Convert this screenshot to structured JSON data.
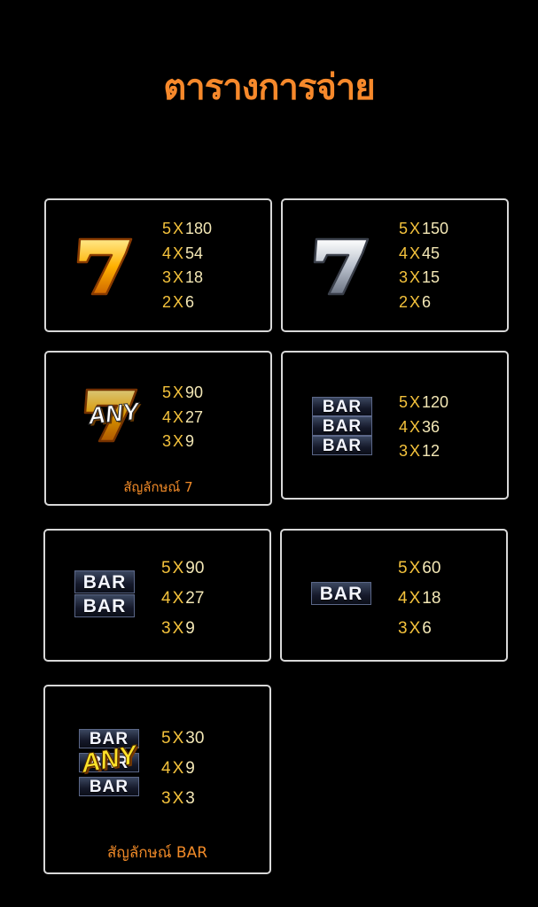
{
  "title": "ตารางการจ่าย",
  "cards": [
    {
      "symbol": "gold-seven-icon",
      "pays": [
        {
          "k": "5",
          "x": "X",
          "v": "180"
        },
        {
          "k": "4",
          "x": "X",
          "v": "54"
        },
        {
          "k": "3",
          "x": "X",
          "v": "18"
        },
        {
          "k": "2",
          "x": "X",
          "v": "6"
        }
      ]
    },
    {
      "symbol": "silver-seven-icon",
      "pays": [
        {
          "k": "5",
          "x": "X",
          "v": "150"
        },
        {
          "k": "4",
          "x": "X",
          "v": "45"
        },
        {
          "k": "3",
          "x": "X",
          "v": "15"
        },
        {
          "k": "2",
          "x": "X",
          "v": "6"
        }
      ]
    },
    {
      "symbol": "any-seven-icon",
      "symbol_text": "ANY",
      "pays": [
        {
          "k": "5",
          "x": "X",
          "v": "90"
        },
        {
          "k": "4",
          "x": "X",
          "v": "27"
        },
        {
          "k": "3",
          "x": "X",
          "v": "9"
        }
      ],
      "caption": "สัญลักษณ์ 7"
    },
    {
      "symbol": "triple-bar-icon",
      "bar_text": "BAR",
      "pays": [
        {
          "k": "5",
          "x": "X",
          "v": "120"
        },
        {
          "k": "4",
          "x": "X",
          "v": "36"
        },
        {
          "k": "3",
          "x": "X",
          "v": "12"
        }
      ]
    },
    {
      "symbol": "double-bar-icon",
      "bar_text": "BAR",
      "pays": [
        {
          "k": "5",
          "x": "X",
          "v": "90"
        },
        {
          "k": "4",
          "x": "X",
          "v": "27"
        },
        {
          "k": "3",
          "x": "X",
          "v": "9"
        }
      ]
    },
    {
      "symbol": "single-bar-icon",
      "bar_text": "BAR",
      "pays": [
        {
          "k": "5",
          "x": "X",
          "v": "60"
        },
        {
          "k": "4",
          "x": "X",
          "v": "18"
        },
        {
          "k": "3",
          "x": "X",
          "v": "6"
        }
      ]
    },
    {
      "symbol": "any-bar-icon",
      "bar_text": "BAR",
      "symbol_text": "ANY",
      "pays": [
        {
          "k": "5",
          "x": "X",
          "v": "30"
        },
        {
          "k": "4",
          "x": "X",
          "v": "9"
        },
        {
          "k": "3",
          "x": "X",
          "v": "3"
        }
      ],
      "caption": "สัญลักษณ์ BAR"
    }
  ],
  "colors": {
    "background": "#000000",
    "title": "#f7892b",
    "border": "#d8d8d8",
    "pay_key": "#f4c23c",
    "pay_value": "#f3e7b5",
    "caption": "#f08a28"
  }
}
